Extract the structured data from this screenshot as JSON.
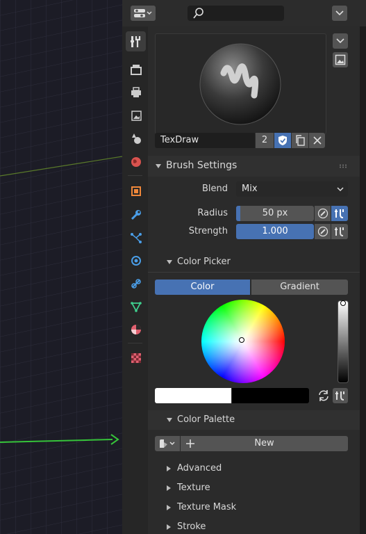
{
  "brush": {
    "name": "TexDraw",
    "users": "2"
  },
  "brush_settings": {
    "title": "Brush Settings",
    "blend_label": "Blend",
    "blend_value": "Mix",
    "radius_label": "Radius",
    "radius_value": "50 px",
    "radius_fraction": 0.0,
    "strength_label": "Strength",
    "strength_value": "1.000",
    "strength_fraction": 1.0
  },
  "color_picker": {
    "title": "Color Picker",
    "tab_color": "Color",
    "tab_gradient": "Gradient",
    "primary_color": "#ffffff",
    "secondary_color": "#000000"
  },
  "color_palette": {
    "title": "Color Palette",
    "new_label": "New"
  },
  "collapsed_panels": [
    "Advanced",
    "Texture",
    "Texture Mask",
    "Stroke"
  ],
  "colors": {
    "accent": "#4772b3",
    "panel_bg": "#2b2b2b"
  }
}
